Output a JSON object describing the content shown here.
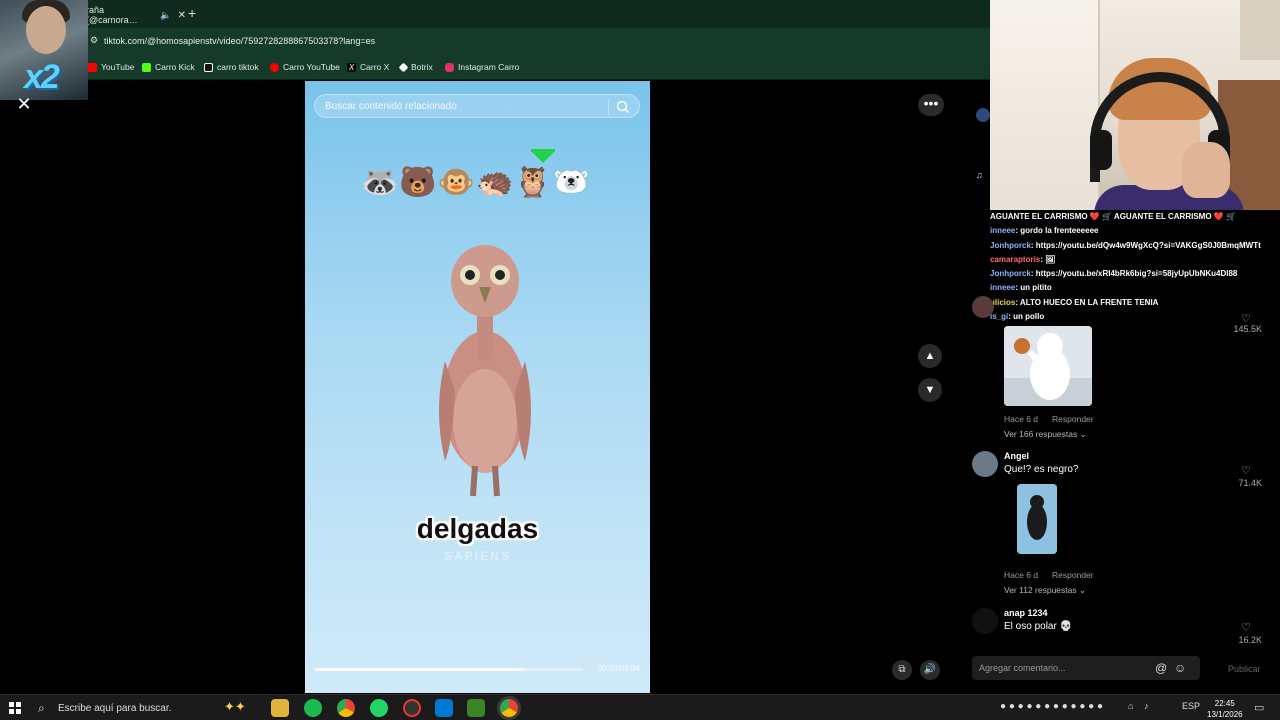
{
  "browser": {
    "tab_title": "raña (@carnora…",
    "new_tab": "+",
    "url": "tiktok.com/@homosapienstv/video/7592728288867503378?lang=es",
    "bookmarks": [
      {
        "label": "YouTube",
        "color": "#ff0000"
      },
      {
        "label": "Carro Kick",
        "color": "#53fc18"
      },
      {
        "label": "carro tiktok",
        "color": "#ffffff"
      },
      {
        "label": "Carro YouTube",
        "color": "#ff0000"
      },
      {
        "label": "Carro X",
        "color": "#ffffff"
      },
      {
        "label": "Botrix",
        "color": "#ffffff"
      },
      {
        "label": "Instagram Carro",
        "color": "#e1306c"
      }
    ]
  },
  "overlay": {
    "multiplier": "x2"
  },
  "video": {
    "search_placeholder": "Buscar contenido relacionado",
    "emojis": "🦝🐻🐵🦔🦉🐻‍❄️",
    "caption": "delgadas",
    "watermark": "SAPIENS",
    "time": "00:50/01:04",
    "progress": 0.78
  },
  "controls": {
    "more": "•••",
    "up": "▲",
    "down": "▼",
    "pip": "⧉",
    "volume": "🔊",
    "close": "✕"
  },
  "chat": [
    {
      "user": "",
      "text": "AGUANTE EL CARRISMO ❤️ 🛒 AGUANTE EL CARRISMO ❤️ 🛒",
      "cls": ""
    },
    {
      "user": "inneee",
      "text": ": gordo la frenteeeeee",
      "cls": "u"
    },
    {
      "user": "Jonhporck",
      "text": ": https://youtu.be/dQw4w9WgXcQ?si=VAKGgS0J0BmqMWTt",
      "cls": "u"
    },
    {
      "user": "camaraptoris",
      "text": ": 🖼",
      "cls": "u2"
    },
    {
      "user": "Jonhporck",
      "text": ": https://youtu.be/xRI4bRk6big?si=58jyUpUbNKu4Dl88",
      "cls": "u"
    },
    {
      "user": "inneee",
      "text": ": un pitito",
      "cls": "u"
    },
    {
      "user": "ulicios",
      "text": ": ALTO HUECO EN LA FRENTE TENIA",
      "cls": "u3"
    },
    {
      "user": "is_gi",
      "text": ": un pollo",
      "cls": "u"
    }
  ],
  "comments": [
    {
      "name": "",
      "text": "",
      "age": "Hace 6 d",
      "reply": "Responder",
      "replies": "Ver 166 respuestas ⌄",
      "likes": "145.5K"
    },
    {
      "name": "Angel",
      "text": "Que!? es negro?",
      "age": "Hace 6 d",
      "reply": "Responder",
      "replies": "Ver 112 respuestas ⌄",
      "likes": "71.4K"
    },
    {
      "name": "anap 1234",
      "text": "El oso polar 💀",
      "likes": "16.2K"
    }
  ],
  "comment_box": {
    "placeholder": "Agregar comentario...",
    "at": "@",
    "emoji": "☺",
    "publish": "Publicar"
  },
  "taskbar": {
    "search": "Escribe aquí para buscar.",
    "lang": "ESP",
    "time": "22:45",
    "date": "13/1/2026"
  }
}
